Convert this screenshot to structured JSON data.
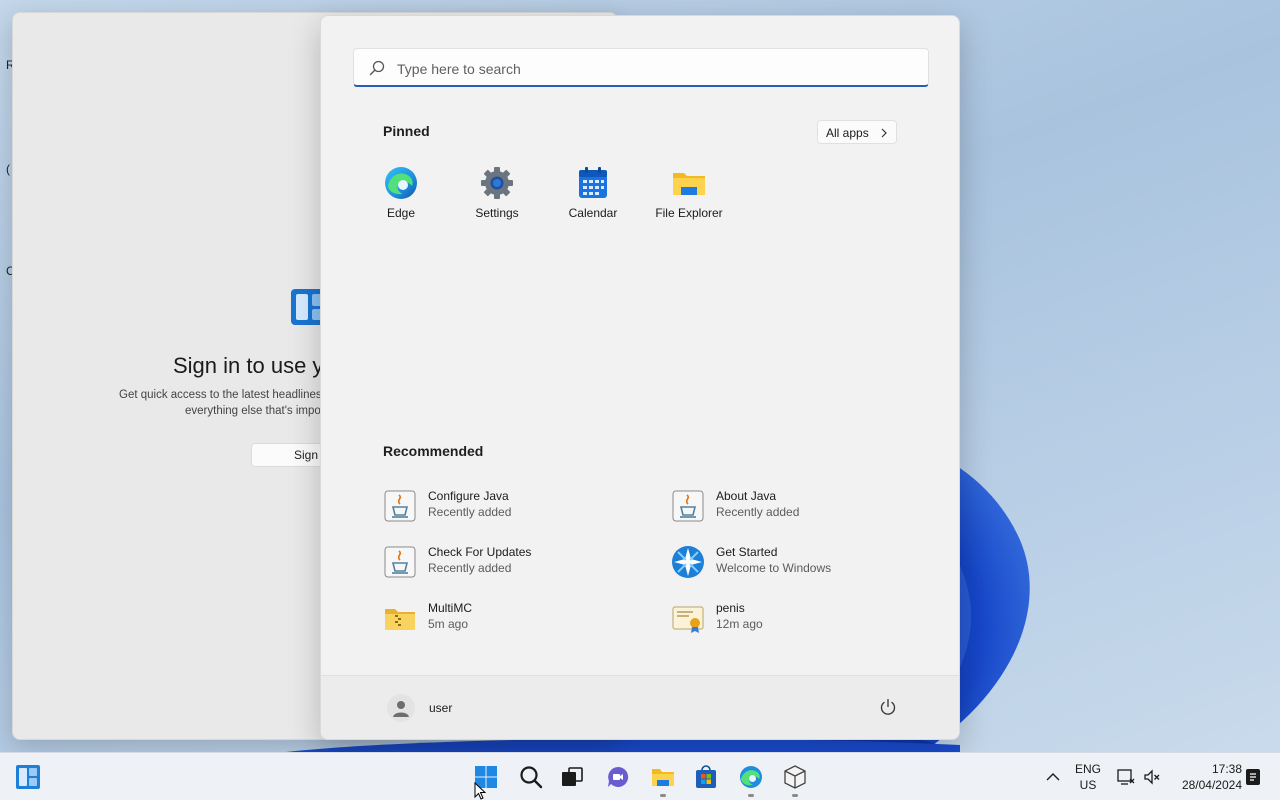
{
  "desktop": {
    "fragments": [
      "R",
      "(",
      "C"
    ]
  },
  "widgets": {
    "title": "Sign in to use y",
    "line1": "Get quick access to the latest headlines, w",
    "line2": "everything else that's impor",
    "signin_label": "Sign i"
  },
  "start_menu": {
    "search_placeholder": "Type here to search",
    "pinned_title": "Pinned",
    "all_apps_label": "All apps",
    "pinned": [
      {
        "label": "Edge",
        "icon": "edge-icon"
      },
      {
        "label": "Settings",
        "icon": "gear-icon"
      },
      {
        "label": "Calendar",
        "icon": "calendar-icon"
      },
      {
        "label": "File Explorer",
        "icon": "folder-icon"
      }
    ],
    "recommended_title": "Recommended",
    "recommended": [
      {
        "name": "Configure Java",
        "sub": "Recently added",
        "icon": "java-icon"
      },
      {
        "name": "About Java",
        "sub": "Recently added",
        "icon": "java-icon"
      },
      {
        "name": "Check For Updates",
        "sub": "Recently added",
        "icon": "java-icon"
      },
      {
        "name": "Get Started",
        "sub": "Welcome to Windows",
        "icon": "get-started-icon"
      },
      {
        "name": "MultiMC",
        "sub": "5m ago",
        "icon": "zip-folder-icon"
      },
      {
        "name": "penis",
        "sub": "12m ago",
        "icon": "certificate-icon"
      }
    ],
    "user_name": "user"
  },
  "taskbar": {
    "lang_top": "ENG",
    "lang_bottom": "US",
    "time": "17:38",
    "date": "28/04/2024"
  },
  "colors": {
    "accent": "#2a5bb8",
    "windows_blue": "#0067c0",
    "bloom_blue": "#1646c8"
  }
}
